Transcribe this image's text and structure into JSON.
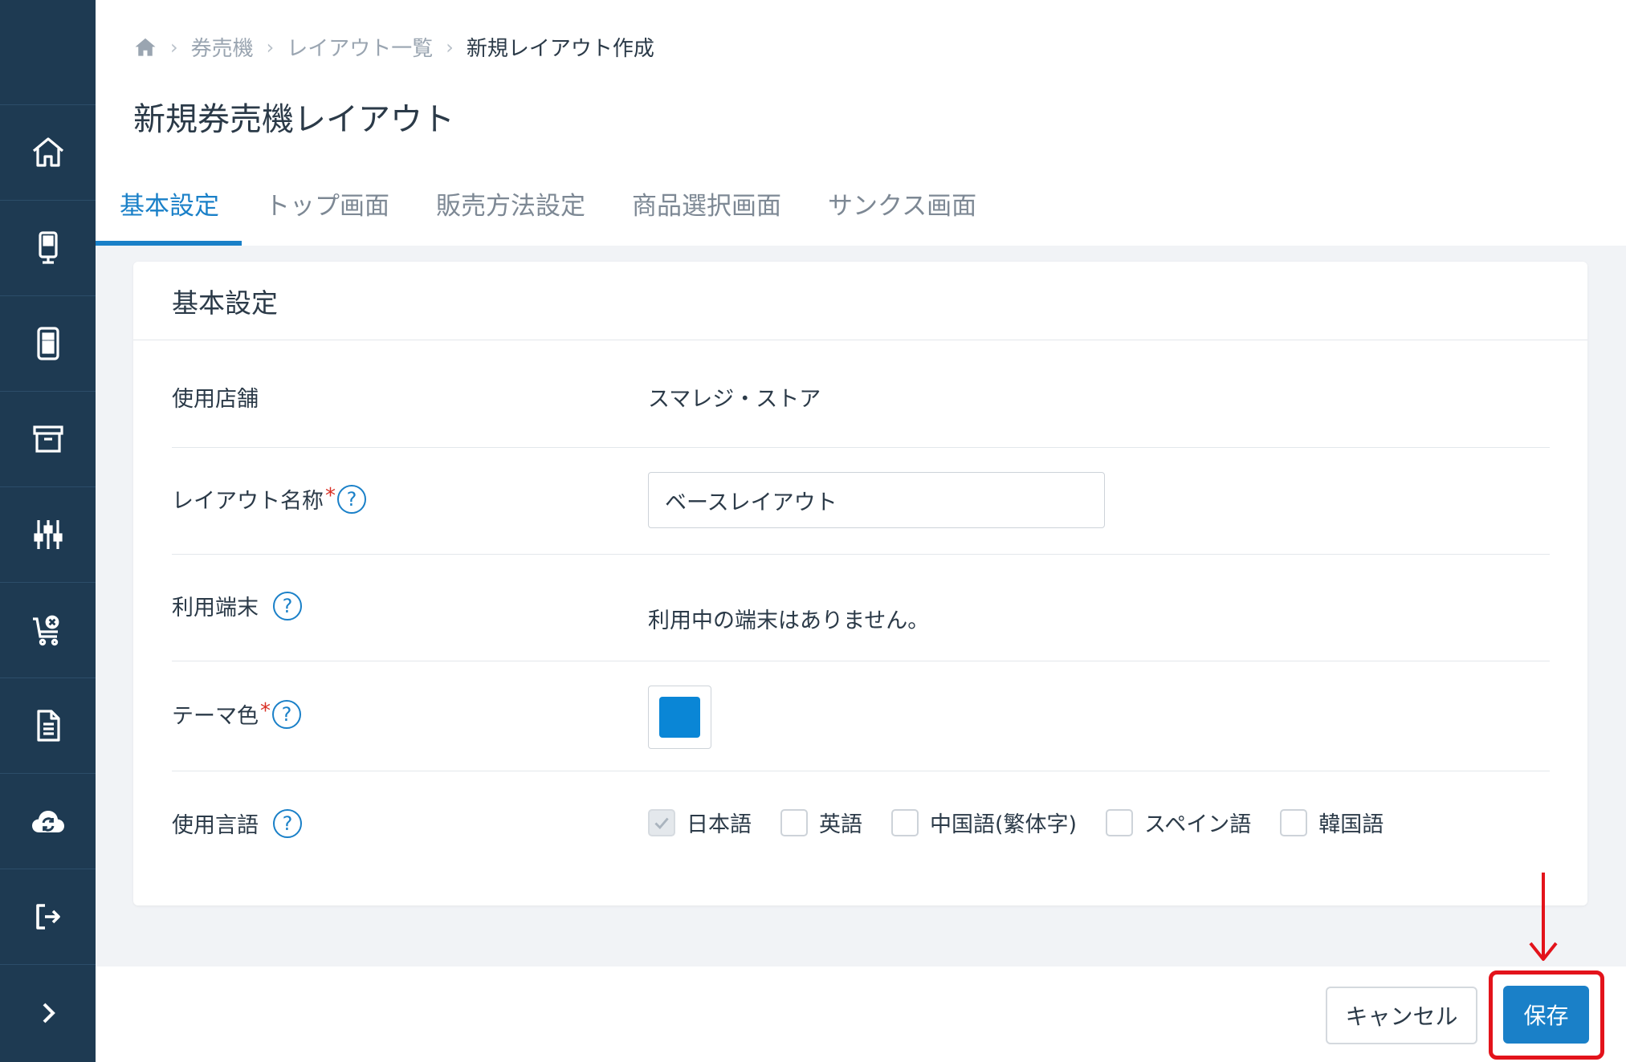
{
  "breadcrumb": {
    "home_icon": "home-icon",
    "items": [
      "券売機",
      "レイアウト一覧",
      "新規レイアウト作成"
    ]
  },
  "page": {
    "title": "新規券売機レイアウト"
  },
  "tabs": [
    {
      "label": "基本設定",
      "active": true
    },
    {
      "label": "トップ画面",
      "active": false
    },
    {
      "label": "販売方法設定",
      "active": false
    },
    {
      "label": "商品選択画面",
      "active": false
    },
    {
      "label": "サンクス画面",
      "active": false
    }
  ],
  "sidebar": {
    "items": [
      {
        "icon": "home-icon"
      },
      {
        "icon": "kiosk-icon"
      },
      {
        "icon": "layout-icon"
      },
      {
        "icon": "archive-icon"
      },
      {
        "icon": "sliders-icon"
      },
      {
        "icon": "cart-cancel-icon"
      },
      {
        "icon": "document-icon"
      },
      {
        "icon": "cloud-sync-icon"
      },
      {
        "icon": "logout-icon"
      },
      {
        "icon": "chevron-right-icon"
      }
    ]
  },
  "card": {
    "title": "基本設定",
    "store": {
      "label": "使用店舗",
      "value": "スマレジ・ストア"
    },
    "layout_name": {
      "label": "レイアウト名称",
      "required": "*",
      "value": "ベースレイアウト"
    },
    "terminals": {
      "label": "利用端末",
      "value": "利用中の端末はありません。"
    },
    "theme_color": {
      "label": "テーマ色",
      "required": "*",
      "color": "#0a86d6"
    },
    "languages": {
      "label": "使用言語",
      "options": [
        {
          "label": "日本語",
          "checked": true
        },
        {
          "label": "英語",
          "checked": false
        },
        {
          "label": "中国語(繁体字)",
          "checked": false
        },
        {
          "label": "スペイン語",
          "checked": false
        },
        {
          "label": "韓国語",
          "checked": false
        }
      ]
    },
    "help_glyph": "?"
  },
  "footer": {
    "cancel_label": "キャンセル",
    "save_label": "保存"
  },
  "colors": {
    "accent": "#1a80c8",
    "sidebar": "#1e3a52",
    "annotation": "#e3131b"
  }
}
